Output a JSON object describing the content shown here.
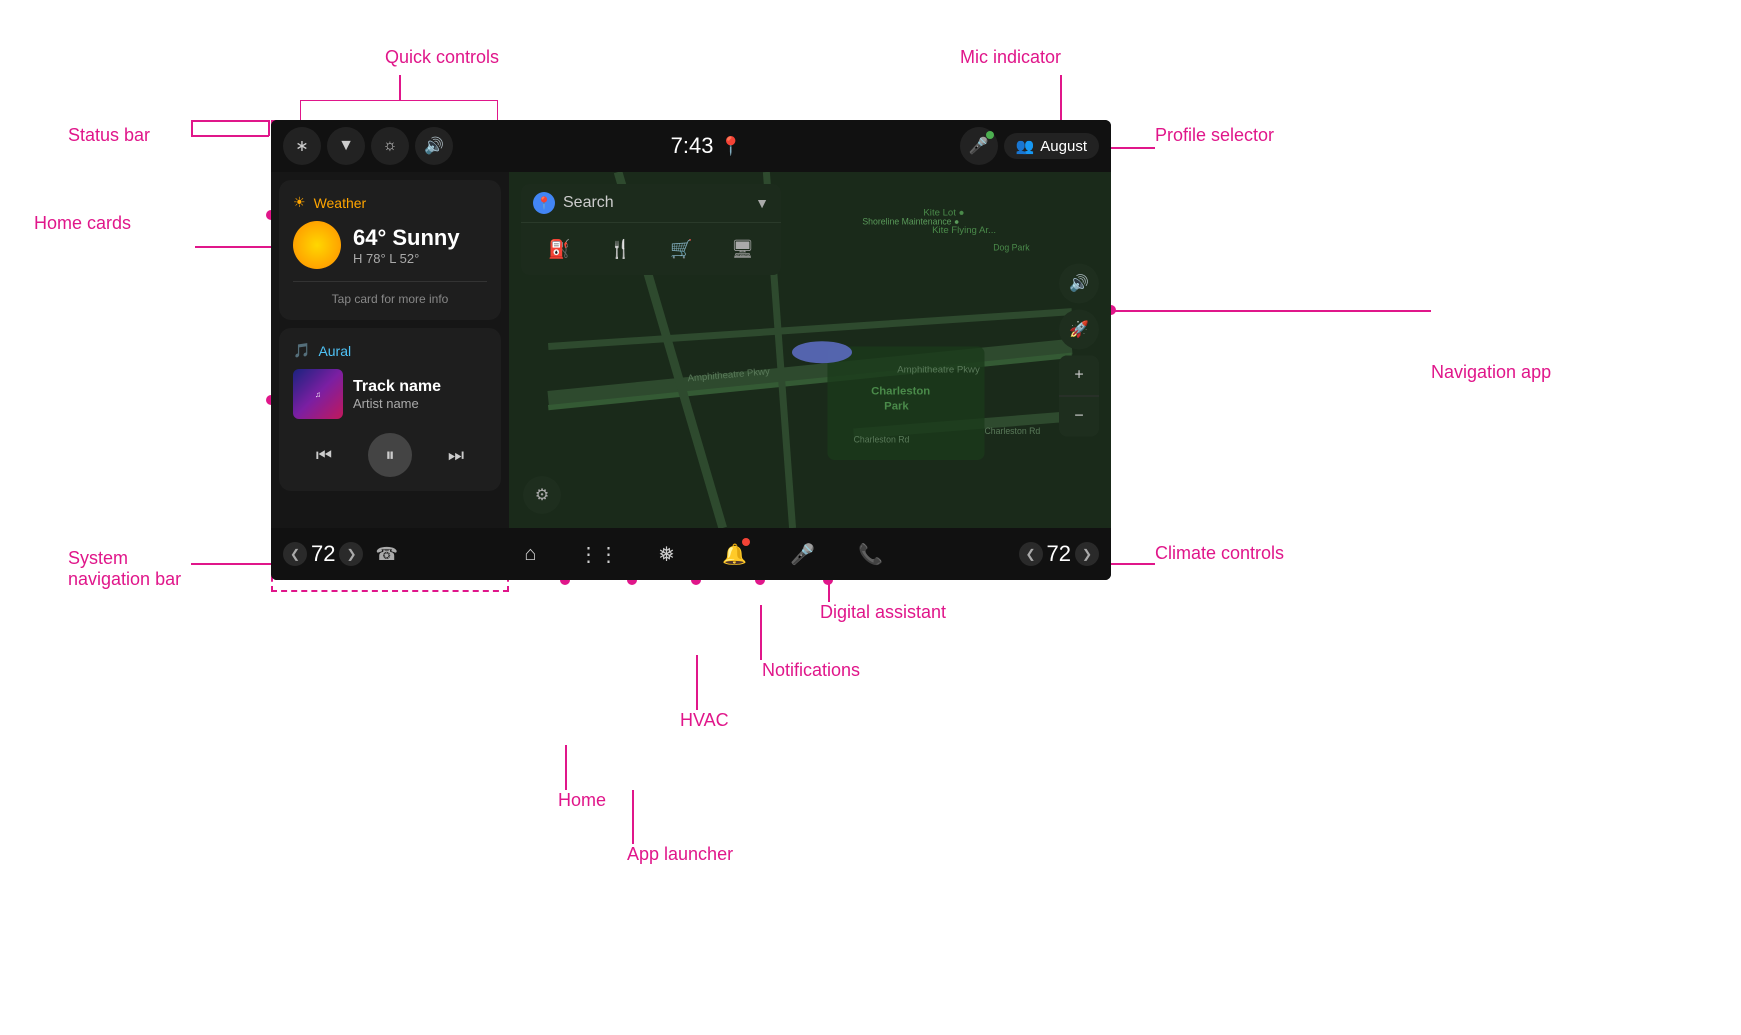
{
  "annotations": {
    "quick_controls": "Quick controls",
    "status_bar": "Status bar",
    "home_cards": "Home cards",
    "mic_indicator": "Mic indicator",
    "profile_selector": "Profile selector",
    "navigation_app": "Navigation app",
    "system_navigation_bar": "System navigation bar",
    "climate_controls": "Climate controls",
    "hvac": "HVAC",
    "app_launcher": "App launcher",
    "home": "Home",
    "notifications": "Notifications",
    "digital_assistant": "Digital assistant"
  },
  "status_bar": {
    "icons": [
      "bluetooth",
      "signal",
      "brightness",
      "volume"
    ],
    "clock": "7:43",
    "profile_name": "August",
    "has_location": true
  },
  "weather_card": {
    "app_name": "Weather",
    "temperature": "64° Sunny",
    "high_low": "H 78° L 52°",
    "tap_hint": "Tap card for more info"
  },
  "music_card": {
    "app_name": "Aural",
    "track_name": "Track name",
    "artist_name": "Artist name"
  },
  "search": {
    "placeholder": "Search",
    "has_chevron": true
  },
  "climate_left": {
    "temp": "72"
  },
  "climate_right": {
    "temp": "72"
  },
  "nav_items": {
    "home": "⌂",
    "app_launcher": "⊞",
    "hvac": "❄",
    "notifications": "🔔",
    "assistant": "🎤"
  }
}
